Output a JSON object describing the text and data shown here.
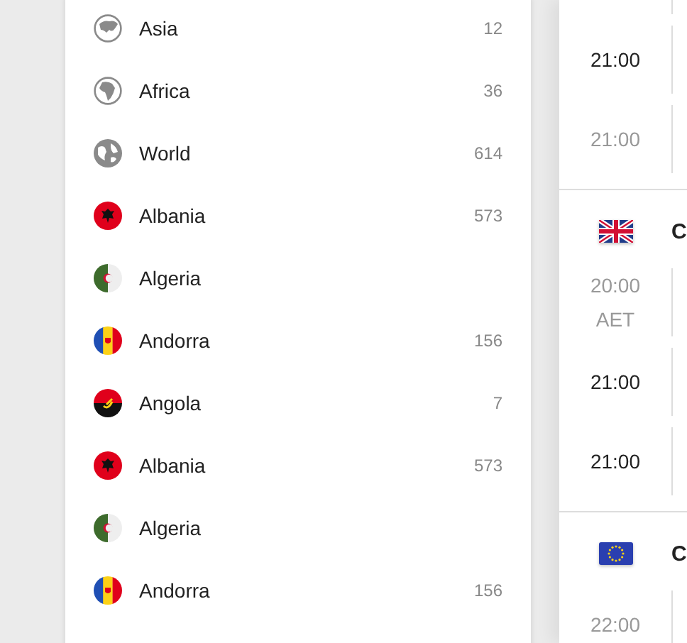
{
  "competitions": [
    {
      "kind": "asia",
      "name": "Asia",
      "count": "12"
    },
    {
      "kind": "africa",
      "name": "Africa",
      "count": "36"
    },
    {
      "kind": "world",
      "name": "World",
      "count": "614"
    },
    {
      "kind": "albania",
      "name": "Albania",
      "count": "573"
    },
    {
      "kind": "algeria",
      "name": "Algeria"
    },
    {
      "kind": "andorra",
      "name": "Andorra",
      "count": "156"
    },
    {
      "kind": "angola",
      "name": "Angola",
      "count": "7"
    },
    {
      "kind": "albania",
      "name": "Albania",
      "count": "573"
    },
    {
      "kind": "algeria",
      "name": "Algeria"
    },
    {
      "kind": "andorra",
      "name": "Andorra",
      "count": "156"
    }
  ],
  "matches_panel": {
    "groups": [
      {
        "matches": [
          {
            "time": "21:00",
            "finished": false
          },
          {
            "time": "21:00",
            "finished": true
          }
        ]
      },
      {
        "kind": "uk",
        "title": "C",
        "matches": [
          {
            "time": "20:00",
            "note": "AET",
            "finished": true
          },
          {
            "time": "21:00",
            "finished": false
          },
          {
            "time": "21:00",
            "finished": false
          }
        ]
      },
      {
        "kind": "eu",
        "title": "C",
        "matches": [
          {
            "time": "22:00",
            "finished": true
          }
        ]
      }
    ]
  }
}
